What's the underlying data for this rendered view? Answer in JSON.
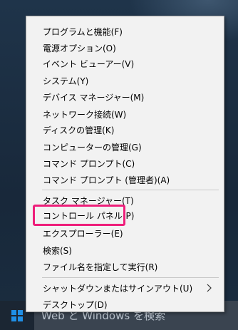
{
  "menu": {
    "items": [
      {
        "label": "プログラムと機能(F)"
      },
      {
        "label": "電源オプション(O)"
      },
      {
        "label": "イベント ビューアー(V)"
      },
      {
        "label": "システム(Y)"
      },
      {
        "label": "デバイス マネージャー(M)"
      },
      {
        "label": "ネットワーク接続(W)"
      },
      {
        "label": "ディスクの管理(K)"
      },
      {
        "label": "コンピューターの管理(G)"
      },
      {
        "label": "コマンド プロンプト(C)"
      },
      {
        "label": "コマンド プロンプト (管理者)(A)"
      },
      {
        "label": "タスク マネージャー(T)"
      },
      {
        "label": "コントロール パネル(P)"
      },
      {
        "label": "エクスプローラー(E)"
      },
      {
        "label": "検索(S)"
      },
      {
        "label": "ファイル名を指定して実行(R)"
      },
      {
        "label": "シャットダウンまたはサインアウト(U)",
        "submenu_icon": "chevron-right-icon"
      },
      {
        "label": "デスクトップ(D)"
      }
    ],
    "highlighted_item": "コントロール パネル(P)",
    "highlight_color": "#ee1e7a"
  },
  "taskbar": {
    "start_icon": "windows-logo-icon",
    "search_text": "Web と Windows を検索"
  }
}
